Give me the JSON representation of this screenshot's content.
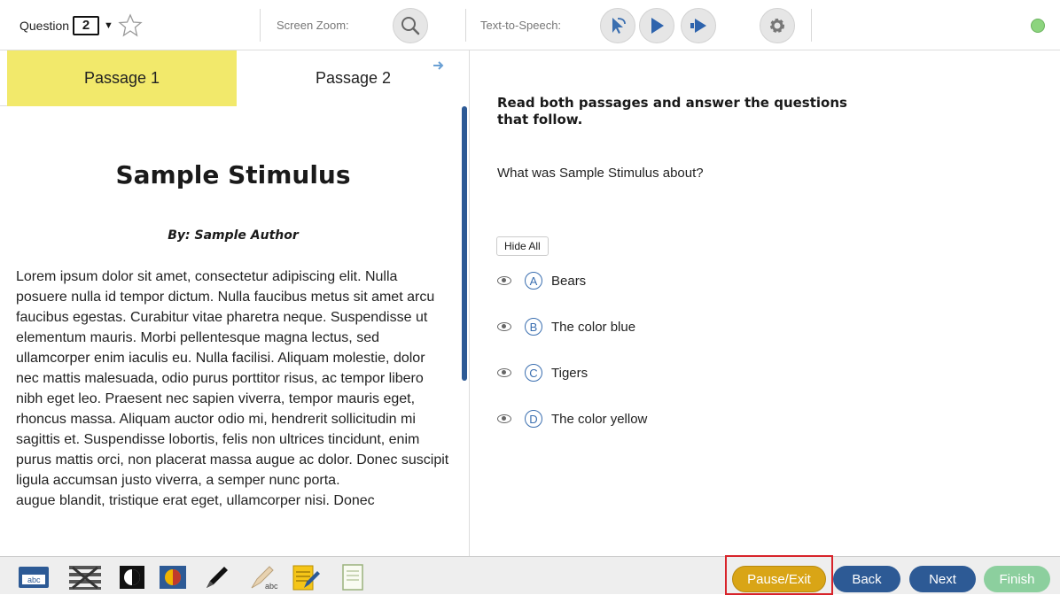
{
  "toolbar": {
    "question_label": "Question",
    "question_number": "2",
    "question_caret": "▼",
    "zoom_label": "Screen Zoom:",
    "tts_label": "Text-to-Speech:"
  },
  "tabs": [
    {
      "label": "Passage 1",
      "active": true
    },
    {
      "label": "Passage 2",
      "active": false
    }
  ],
  "passage": {
    "title": "Sample Stimulus",
    "author": "By: Sample Author",
    "body": "Lorem ipsum dolor sit amet, consectetur adipiscing elit. Nulla posuere nulla id tempor dictum. Nulla faucibus metus sit amet arcu faucibus egestas. Curabitur vitae pharetra neque. Suspendisse ut elementum mauris. Morbi pellentesque magna lectus, sed ullamcorper enim iaculis eu. Nulla facilisi. Aliquam molestie, dolor nec mattis malesuada, odio purus porttitor risus, ac tempor libero nibh eget leo. Praesent nec sapien viverra, tempor mauris eget, rhoncus massa. Aliquam auctor odio mi, hendrerit sollicitudin mi sagittis et. Suspendisse lobortis, felis non ultrices tincidunt, enim purus mattis orci, non placerat massa augue ac dolor. Donec suscipit ligula accumsan justo viverra, a semper nunc porta.",
    "body_cut": "augue blandit, tristique erat eget, ullamcorper nisi. Donec"
  },
  "question": {
    "instructions": "Read both passages and answer the questions that follow.",
    "prompt": "What was Sample Stimulus about?",
    "hide_all_label": "Hide All",
    "choices": [
      {
        "letter": "A",
        "text": "Bears"
      },
      {
        "letter": "B",
        "text": "The color blue"
      },
      {
        "letter": "C",
        "text": "Tigers"
      },
      {
        "letter": "D",
        "text": "The color yellow"
      }
    ]
  },
  "tools": {
    "abc_label": "abc",
    "strikeout_label": "abc"
  },
  "nav": {
    "pause_label": "Pause/Exit",
    "back_label": "Back",
    "next_label": "Next",
    "finish_label": "Finish"
  },
  "colors": {
    "active_tab": "#f2e96b",
    "accent_blue": "#2d5a95",
    "pause_gold": "#d9a516",
    "finish_disabled": "#8ccf9e",
    "highlight_frame": "#d8232a",
    "status_green": "#8cd47e"
  },
  "icons": [
    "star-icon",
    "search-icon",
    "pointer-speak-icon",
    "play-icon",
    "fast-forward-icon",
    "gear-icon",
    "arrow-right-icon",
    "eye-icon"
  ]
}
